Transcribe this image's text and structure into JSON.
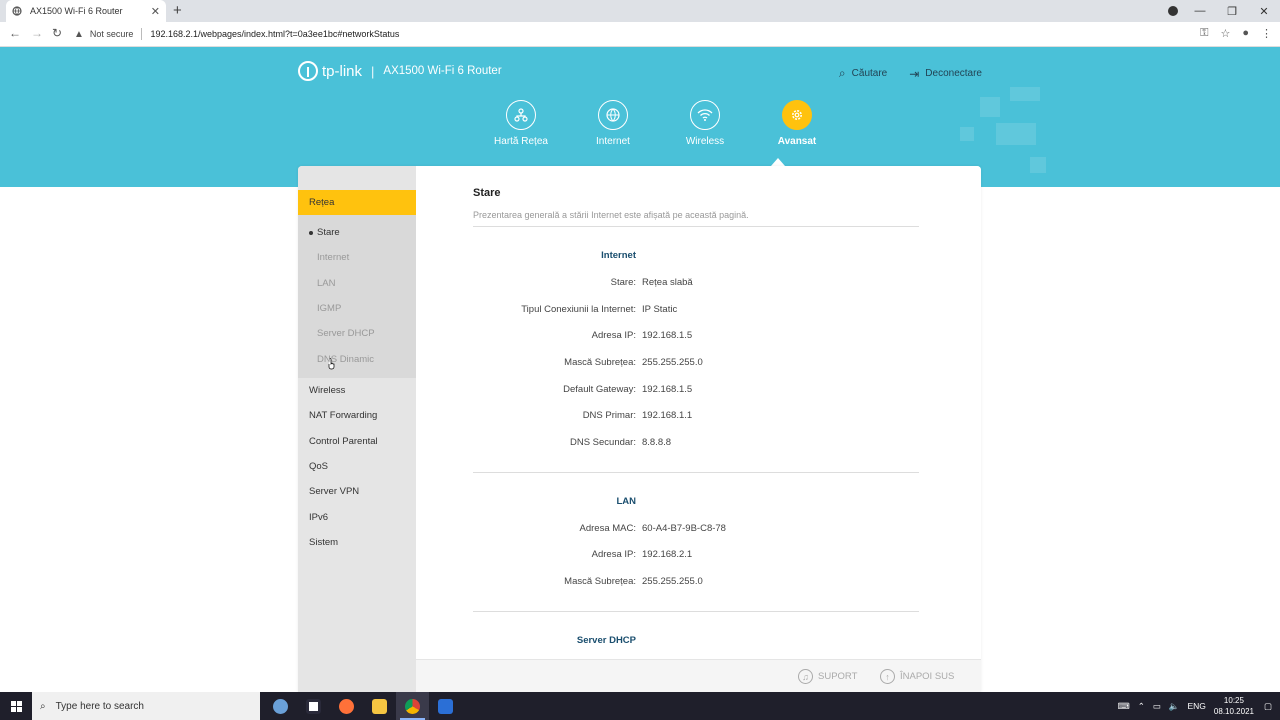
{
  "browser": {
    "tab_title": "AX1500 Wi-Fi 6 Router",
    "security_label": "Not secure",
    "url": "192.168.2.1/webpages/index.html?t=0a3ee1bc#networkStatus"
  },
  "header": {
    "brand": "tp-link",
    "product": "AX1500 Wi-Fi 6 Router",
    "search_label": "Căutare",
    "logout_label": "Deconectare"
  },
  "mainnav": [
    {
      "label": "Hartă Rețea",
      "icon": "network-map-icon"
    },
    {
      "label": "Internet",
      "icon": "globe-icon"
    },
    {
      "label": "Wireless",
      "icon": "wifi-icon"
    },
    {
      "label": "Avansat",
      "icon": "gear-icon",
      "active": true
    }
  ],
  "sidebar": {
    "section": "Rețea",
    "subitems": [
      "Stare",
      "Internet",
      "LAN",
      "IGMP",
      "Server DHCP",
      "DNS Dinamic"
    ],
    "items": [
      "Wireless",
      "NAT Forwarding",
      "Control Parental",
      "QoS",
      "Server VPN",
      "IPv6",
      "Sistem"
    ]
  },
  "content": {
    "title": "Stare",
    "description": "Prezentarea generală a stării Internet este afișată pe această pagină.",
    "internet": {
      "title": "Internet",
      "rows": [
        {
          "label": "Stare:",
          "value": "Rețea slabă"
        },
        {
          "label": "Tipul Conexiunii la Internet:",
          "value": "IP Static"
        },
        {
          "label": "Adresa IP:",
          "value": "192.168.1.5"
        },
        {
          "label": "Mască Subrețea:",
          "value": "255.255.255.0"
        },
        {
          "label": "Default Gateway:",
          "value": "192.168.1.5"
        },
        {
          "label": "DNS Primar:",
          "value": "192.168.1.1"
        },
        {
          "label": "DNS Secundar:",
          "value": "8.8.8.8"
        }
      ]
    },
    "lan": {
      "title": "LAN",
      "rows": [
        {
          "label": "Adresa MAC:",
          "value": "60-A4-B7-9B-C8-78"
        },
        {
          "label": "Adresa IP:",
          "value": "192.168.2.1"
        },
        {
          "label": "Mască Subrețea:",
          "value": "255.255.255.0"
        }
      ]
    },
    "dhcp_title": "Server DHCP"
  },
  "footer": {
    "support": "SUPORT",
    "back_top": "ÎNAPOI SUS"
  },
  "taskbar": {
    "search_placeholder": "Type here to search",
    "lang": "ENG",
    "time": "10:25",
    "date": "08.10.2021"
  },
  "colors": {
    "banner": "#4ac1d8",
    "accent": "#ffc20e",
    "section_title": "#1a4e6e"
  }
}
